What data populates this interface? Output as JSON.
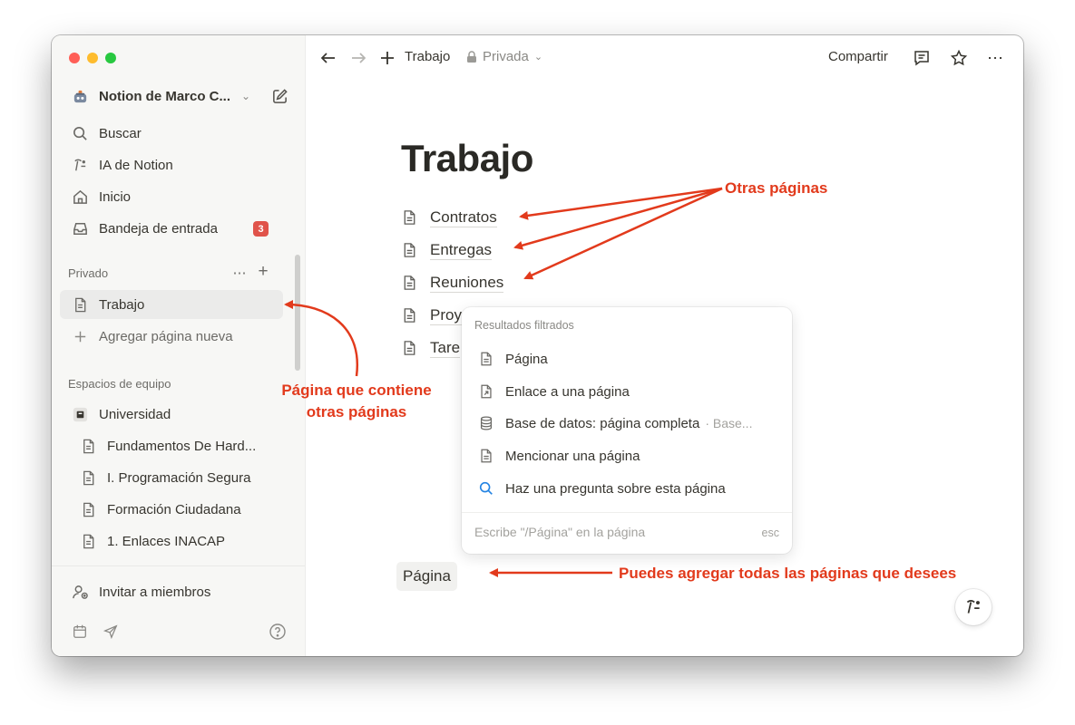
{
  "window": {
    "traffic_colors": [
      "#ff5f57",
      "#febc2e",
      "#28c840"
    ]
  },
  "sidebar": {
    "workspace_name": "Notion de Marco C...",
    "nav": [
      {
        "label": "Buscar",
        "icon": "search-icon"
      },
      {
        "label": "IA de Notion",
        "icon": "notion-ai-icon"
      },
      {
        "label": "Inicio",
        "icon": "home-icon"
      },
      {
        "label": "Bandeja de entrada",
        "icon": "inbox-icon",
        "badge": "3"
      }
    ],
    "private_label": "Privado",
    "private_pages": [
      {
        "label": "Trabajo",
        "icon": "page-icon"
      },
      {
        "label": "Agregar página nueva",
        "icon": "plus-icon"
      }
    ],
    "teamspaces_label": "Espacios de equipo",
    "teamspace": {
      "label": "Universidad",
      "icon": "teamspace-icon"
    },
    "teamspace_pages": [
      {
        "label": "Fundamentos De Hard...",
        "icon": "page-icon"
      },
      {
        "label": "I. Programación Segura",
        "icon": "page-icon"
      },
      {
        "label": "Formación Ciudadana",
        "icon": "page-icon"
      },
      {
        "label": "1. Enlaces INACAP",
        "icon": "page-icon"
      }
    ],
    "invite_label": "Invitar a miembros",
    "badge_color": "#e0534a"
  },
  "topbar": {
    "breadcrumb": "Trabajo",
    "privacy": "Privada",
    "share_label": "Compartir"
  },
  "page": {
    "title": "Trabajo",
    "links": [
      "Contratos",
      "Entregas",
      "Reuniones",
      "Proy",
      "Tare"
    ],
    "chip": "Página"
  },
  "popup": {
    "header": "Resultados filtrados",
    "items": [
      {
        "label": "Página",
        "icon": "page-icon"
      },
      {
        "label": "Enlace a una página",
        "icon": "page-link-icon"
      },
      {
        "label": "Base de datos: página completa",
        "sub": "· Base...",
        "icon": "database-icon"
      },
      {
        "label": "Mencionar una página",
        "icon": "page-icon"
      },
      {
        "label": "Haz una pregunta sobre esta página",
        "icon": "search-icon"
      }
    ],
    "footer_hint": "Escribe \"/Página\" en la página",
    "esc": "esc"
  },
  "annotations": {
    "other_pages": "Otras páginas",
    "container_line1": "Página que contiene",
    "container_line2": "otras páginas",
    "add_all": "Puedes agregar todas las páginas que desees",
    "color": "#e23a1c"
  }
}
